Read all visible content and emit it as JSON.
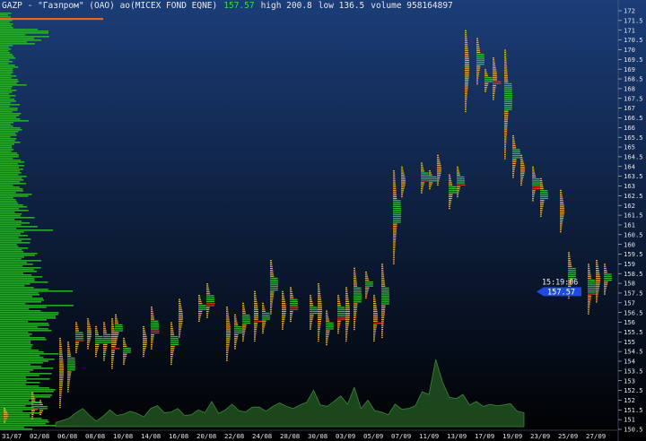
{
  "header": {
    "symbol": "GAZP",
    "name": "- \"Газпром\" (ОАО) ао(MICEX FOND EQNE)",
    "last": "157.57",
    "high": "high 200.8",
    "low": "low 136.5",
    "volume": "volume 958164897"
  },
  "price_tag": {
    "time": "15:19:06",
    "price": "157.57"
  },
  "colors": {
    "background_top": "#1b3d78",
    "background_bottom": "#000000",
    "volume_profile": "#2fb52f",
    "up_tick": "#f2a332",
    "down_tick": "#c8c030",
    "bull_bar": "#2fbf2f",
    "bear_bar": "#e03020",
    "volume_area": "#1e4a1e",
    "price_tag": "#1f49e0",
    "poc_line": "#e06a28"
  },
  "chart_data": {
    "type": "bar",
    "title": "",
    "y_ticks": [
      "172",
      "171.5",
      "171",
      "170.5",
      "170",
      "169.5",
      "169",
      "168.5",
      "168",
      "167.5",
      "167",
      "166.5",
      "166",
      "165.5",
      "165",
      "164.5",
      "164",
      "163.5",
      "163",
      "162.5",
      "162",
      "161.5",
      "161",
      "160.5",
      "160",
      "159.5",
      "159",
      "158.5",
      "158",
      "157.5",
      "157",
      "156.5",
      "156",
      "155.5",
      "155",
      "154.5",
      "154",
      "153.5",
      "153",
      "152.5",
      "152",
      "151.5",
      "151",
      "150.5"
    ],
    "x_labels": [
      "31/07",
      "02/08",
      "06/08",
      "08/08",
      "10/08",
      "14/08",
      "16/08",
      "20/08",
      "22/08",
      "24/08",
      "28/08",
      "30/08",
      "03/09",
      "05/09",
      "07/09",
      "11/09",
      "13/09",
      "17/09",
      "19/09",
      "23/09",
      "25/09",
      "27/09"
    ],
    "ylim": [
      150.5,
      172
    ],
    "series": [
      {
        "values": [
          {
            "d": "31/07",
            "lo": 150.8,
            "hi": 151.6
          },
          {
            "d": "02/08",
            "lo": 151.0,
            "hi": 152.4
          },
          {
            "d": "02/08",
            "lo": 151.2,
            "hi": 152.0
          },
          {
            "d": "06/08",
            "lo": 151.6,
            "hi": 155.2
          },
          {
            "d": "06/08",
            "lo": 152.4,
            "hi": 155.0
          },
          {
            "d": "06/08",
            "lo": 154.4,
            "hi": 156.0
          },
          {
            "d": "08/08",
            "lo": 154.6,
            "hi": 156.2
          },
          {
            "d": "08/08",
            "lo": 154.2,
            "hi": 155.8
          },
          {
            "d": "08/08",
            "lo": 154.0,
            "hi": 156.0
          },
          {
            "d": "08/08",
            "lo": 153.6,
            "hi": 156.2
          },
          {
            "d": "10/08",
            "lo": 154.8,
            "hi": 156.4
          },
          {
            "d": "10/08",
            "lo": 153.8,
            "hi": 155.2
          },
          {
            "d": "14/08",
            "lo": 154.2,
            "hi": 155.8
          },
          {
            "d": "14/08",
            "lo": 154.6,
            "hi": 156.8
          },
          {
            "d": "16/08",
            "lo": 153.8,
            "hi": 156.0
          },
          {
            "d": "16/08",
            "lo": 155.2,
            "hi": 157.2
          },
          {
            "d": "20/08",
            "lo": 156.0,
            "hi": 157.4
          },
          {
            "d": "20/08",
            "lo": 156.2,
            "hi": 158.0
          },
          {
            "d": "22/08",
            "lo": 154.0,
            "hi": 156.8
          },
          {
            "d": "22/08",
            "lo": 154.6,
            "hi": 156.4
          },
          {
            "d": "22/08",
            "lo": 155.0,
            "hi": 157.0
          },
          {
            "d": "24/08",
            "lo": 155.0,
            "hi": 157.6
          },
          {
            "d": "24/08",
            "lo": 155.4,
            "hi": 157.0
          },
          {
            "d": "24/08",
            "lo": 156.4,
            "hi": 159.2
          },
          {
            "d": "28/08",
            "lo": 155.6,
            "hi": 157.6
          },
          {
            "d": "28/08",
            "lo": 156.0,
            "hi": 157.8
          },
          {
            "d": "30/08",
            "lo": 155.6,
            "hi": 157.4
          },
          {
            "d": "30/08",
            "lo": 155.0,
            "hi": 158.0
          },
          {
            "d": "30/08",
            "lo": 154.8,
            "hi": 156.6
          },
          {
            "d": "03/09",
            "lo": 155.4,
            "hi": 157.4
          },
          {
            "d": "03/09",
            "lo": 155.0,
            "hi": 157.8
          },
          {
            "d": "03/09",
            "lo": 155.6,
            "hi": 158.8
          },
          {
            "d": "05/09",
            "lo": 157.2,
            "hi": 158.6
          },
          {
            "d": "05/09",
            "lo": 155.0,
            "hi": 157.4
          },
          {
            "d": "05/09",
            "lo": 155.2,
            "hi": 159.0
          },
          {
            "d": "07/09",
            "lo": 159.0,
            "hi": 163.8
          },
          {
            "d": "07/09",
            "lo": 162.4,
            "hi": 164.0
          },
          {
            "d": "11/09",
            "lo": 162.6,
            "hi": 164.2
          },
          {
            "d": "11/09",
            "lo": 162.8,
            "hi": 163.8
          },
          {
            "d": "11/09",
            "lo": 163.0,
            "hi": 164.6
          },
          {
            "d": "13/09",
            "lo": 161.8,
            "hi": 163.6
          },
          {
            "d": "13/09",
            "lo": 162.4,
            "hi": 164.0
          },
          {
            "d": "13/09",
            "lo": 166.8,
            "hi": 171.0
          },
          {
            "d": "17/09",
            "lo": 168.2,
            "hi": 170.6
          },
          {
            "d": "17/09",
            "lo": 167.8,
            "hi": 169.0
          },
          {
            "d": "17/09",
            "lo": 167.4,
            "hi": 169.6
          },
          {
            "d": "19/09",
            "lo": 164.4,
            "hi": 170.0
          },
          {
            "d": "19/09",
            "lo": 163.4,
            "hi": 165.6
          },
          {
            "d": "19/09",
            "lo": 163.0,
            "hi": 164.6
          },
          {
            "d": "23/09",
            "lo": 162.2,
            "hi": 164.0
          },
          {
            "d": "23/09",
            "lo": 161.4,
            "hi": 163.4
          },
          {
            "d": "25/09",
            "lo": 160.6,
            "hi": 162.8
          },
          {
            "d": "25/09",
            "lo": 157.2,
            "hi": 159.6
          },
          {
            "d": "27/09",
            "lo": 156.4,
            "hi": 159.0
          },
          {
            "d": "27/09",
            "lo": 157.0,
            "hi": 159.2
          },
          {
            "d": "27/09",
            "lo": 157.4,
            "hi": 159.0
          }
        ]
      },
      {
        "values": [
          0.6,
          0.9,
          1.2,
          2.0,
          2.6,
          1.6,
          0.8,
          1.5,
          2.4,
          1.6,
          1.8,
          2.2,
          1.9,
          1.4,
          2.6,
          3.0,
          2.0,
          2.1,
          2.6,
          1.6,
          1.7,
          2.4,
          2.0,
          3.6,
          1.9,
          2.4,
          3.2,
          2.3,
          2.1,
          2.8,
          2.8,
          2.2,
          2.9,
          3.4,
          2.9,
          2.6,
          3.1,
          3.5,
          5.2,
          3.1,
          2.9,
          3.6,
          4.4,
          3.2,
          5.6,
          2.6,
          3.8,
          2.3,
          2.1,
          1.7,
          3.2,
          2.5,
          2.6,
          3.0,
          5.0,
          4.6,
          9.6,
          6.4,
          4.2,
          4.0,
          4.6,
          3.1,
          3.6,
          2.9,
          3.2,
          3.0,
          3.1,
          3.3,
          2.2,
          2.0
        ]
      }
    ]
  }
}
